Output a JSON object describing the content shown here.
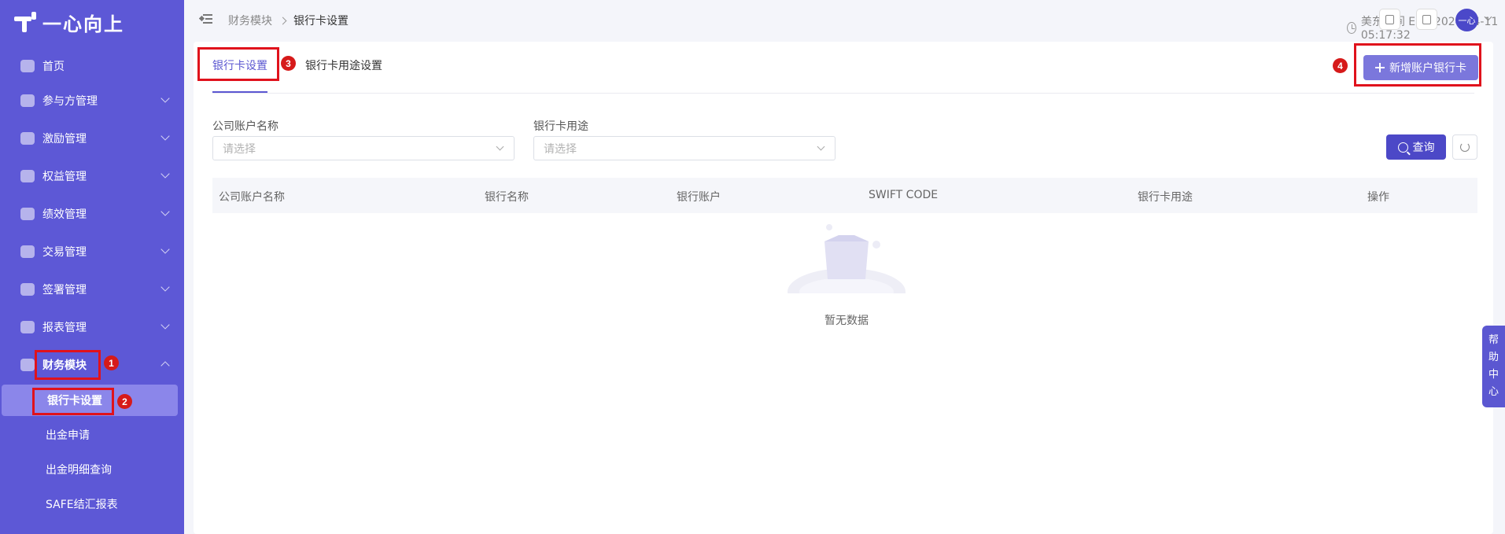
{
  "app": {
    "logo_text": "一心向上"
  },
  "sidebar": {
    "items": [
      {
        "label": "首页",
        "icon": "home-icon"
      },
      {
        "label": "参与方管理",
        "icon": "participant-icon"
      },
      {
        "label": "激励管理",
        "icon": "incentive-icon"
      },
      {
        "label": "权益管理",
        "icon": "equity-icon"
      },
      {
        "label": "绩效管理",
        "icon": "performance-icon"
      },
      {
        "label": "交易管理",
        "icon": "trade-icon"
      },
      {
        "label": "签署管理",
        "icon": "sign-icon"
      },
      {
        "label": "报表管理",
        "icon": "report-icon"
      },
      {
        "label": "财务模块",
        "icon": "finance-icon"
      }
    ],
    "finance_children": [
      {
        "label": "银行卡设置"
      },
      {
        "label": "出金申请"
      },
      {
        "label": "出金明细查询"
      },
      {
        "label": "SAFE结汇报表"
      }
    ]
  },
  "header": {
    "breadcrumb": [
      "财务模块",
      "银行卡设置"
    ],
    "clock_text": "美东时间 EDT 2024-04-11 05:17:32",
    "avatar_text": "一心"
  },
  "tabs": [
    {
      "label": "银行卡设置"
    },
    {
      "label": "银行卡用途设置"
    }
  ],
  "toolbar": {
    "add_label": "新增账户银行卡"
  },
  "filters": {
    "company_label": "公司账户名称",
    "company_placeholder": "请选择",
    "usage_label": "银行卡用途",
    "usage_placeholder": "请选择",
    "query_label": "查询"
  },
  "table": {
    "columns": [
      "公司账户名称",
      "银行名称",
      "银行账户",
      "SWIFT CODE",
      "银行卡用途",
      "操作"
    ],
    "empty_text": "暂无数据"
  },
  "help": {
    "chars": [
      "帮",
      "助",
      "中",
      "心"
    ]
  },
  "annotations": [
    "1",
    "2",
    "3",
    "4"
  ],
  "colors": {
    "sidebar": "#5d58d6",
    "accent": "#5b57d1",
    "annotation": "#e0121c"
  }
}
